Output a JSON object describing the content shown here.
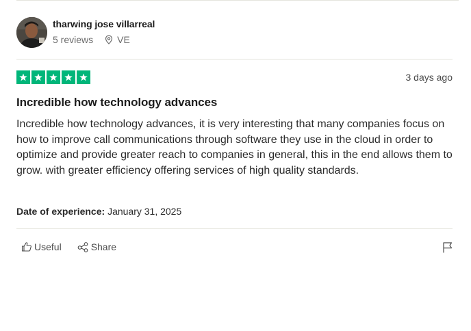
{
  "reviewer": {
    "name": "tharwing jose villarreal",
    "reviews": "5 reviews",
    "country": "VE",
    "avatar_icon": "avatar-photo",
    "location_icon": "location-pin-icon"
  },
  "review": {
    "rating": 5,
    "max_rating": 5,
    "star_color": "#00b67a",
    "date_ago": "3 days ago",
    "title": "Incredible how technology advances",
    "body": "Incredible how technology advances, it is very interesting that many companies focus on how to improve call communications through software they use in the cloud in order to optimize and provide greater reach to companies in general, this in the end allows them to grow. with greater efficiency offering services of high quality standards.",
    "experience_label": "Date of experience:",
    "experience_date": "January 31, 2025"
  },
  "actions": {
    "useful_label": "Useful",
    "useful_icon": "thumbs-up-icon",
    "share_label": "Share",
    "share_icon": "share-icon",
    "report_icon": "flag-icon"
  }
}
